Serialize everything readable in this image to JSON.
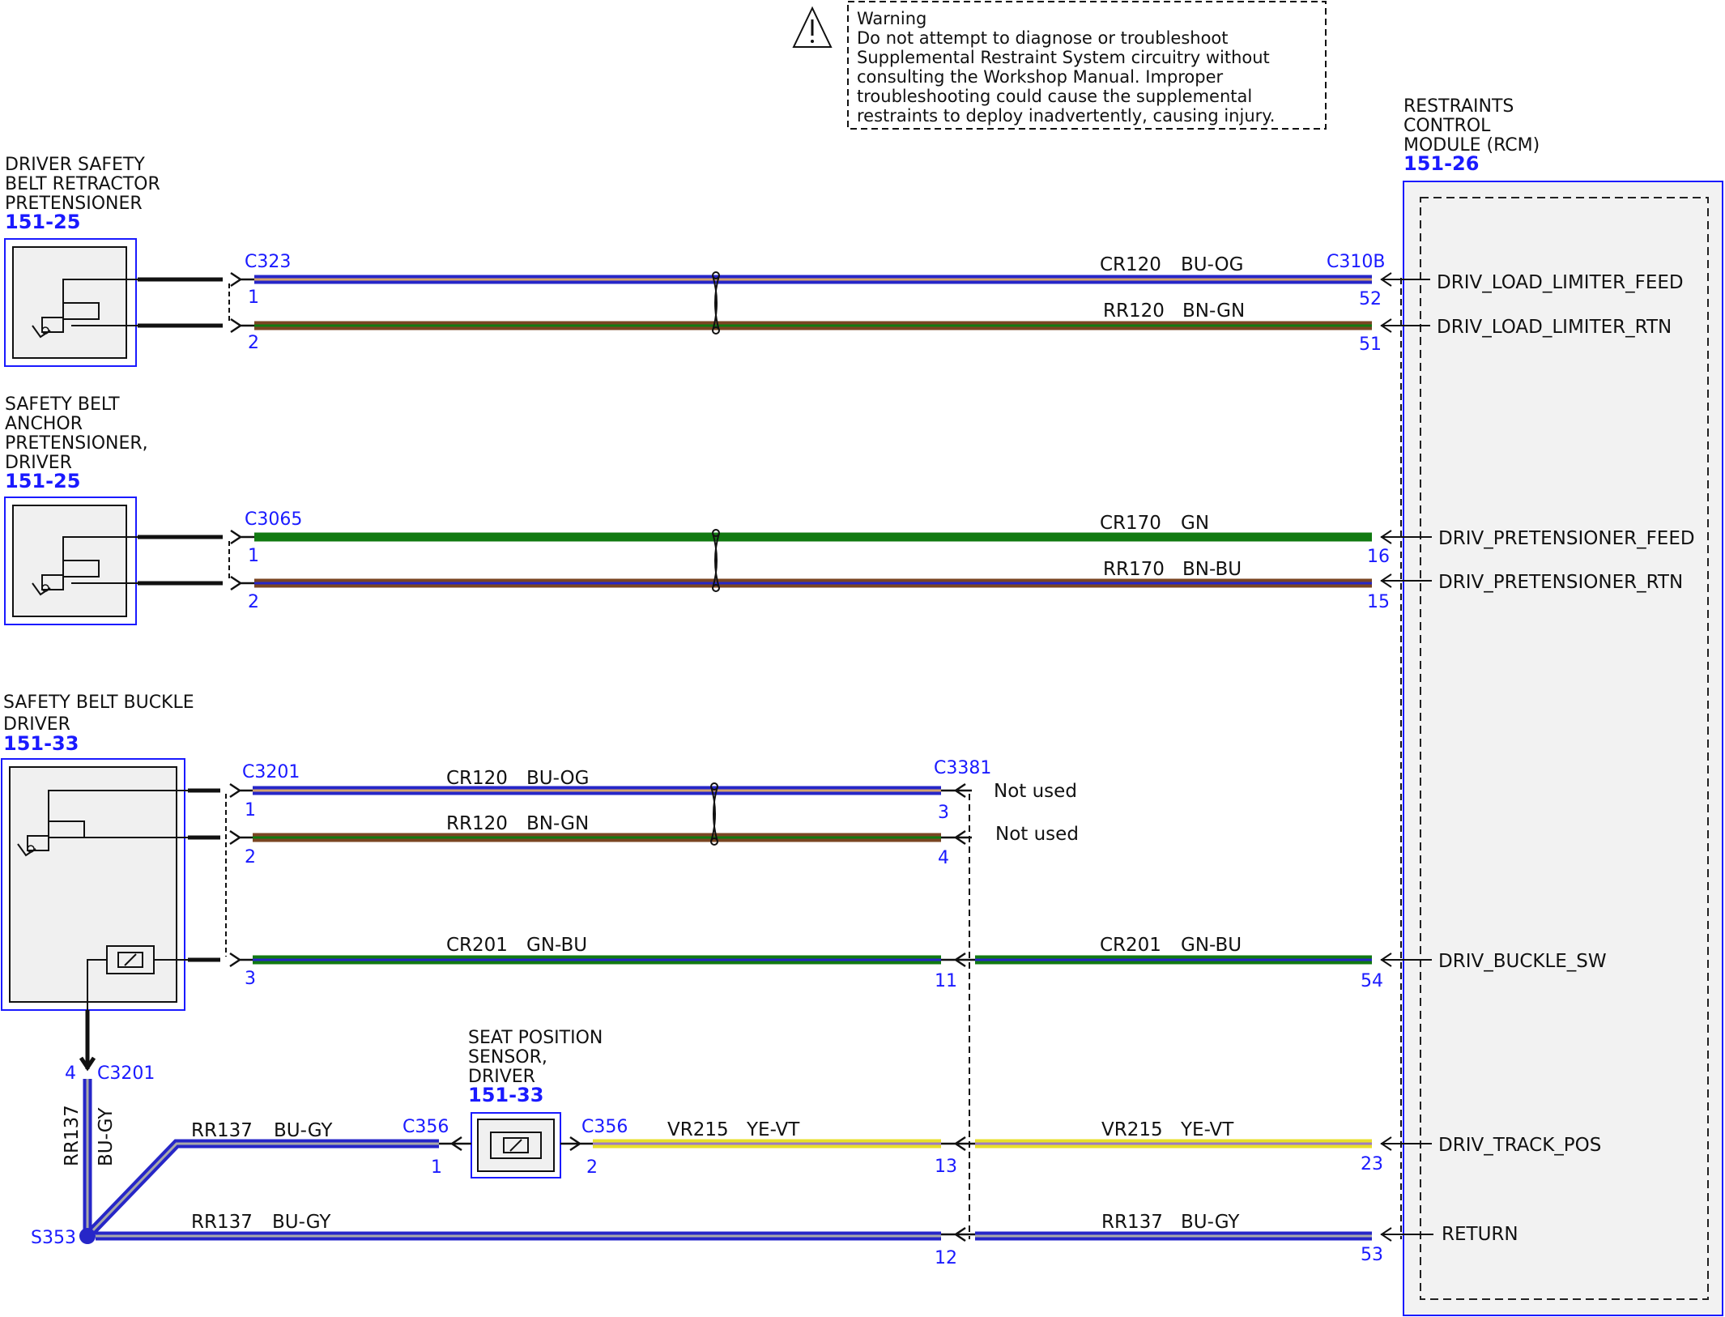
{
  "colors": {
    "BU": "#2626c8",
    "OG": "#d4a26e",
    "BN": "#7a4522",
    "GN": "#117a11",
    "GY": "#a9a9a9",
    "YE": "#e8df2a",
    "VT": "#9c7bc4",
    "component_border": "#1a1aff",
    "text_blue": "#1a1aff"
  },
  "warning": {
    "icon": "warning-triangle-icon",
    "lines": [
      "Warning",
      "Do not attempt to diagnose or troubleshoot",
      "Supplemental Restraint System circuitry without",
      "consulting the Workshop Manual. Improper",
      "troubleshooting could cause the supplemental",
      "restraints to deploy inadvertently, causing injury."
    ]
  },
  "rcm": {
    "name_lines": [
      "RESTRAINTS",
      "CONTROL",
      "MODULE (RCM)"
    ],
    "ref": "151-26",
    "connector": "C310B",
    "pins": [
      {
        "pin": "52",
        "signal": "DRIV_LOAD_LIMITER_FEED"
      },
      {
        "pin": "51",
        "signal": "DRIV_LOAD_LIMITER_RTN"
      },
      {
        "pin": "16",
        "signal": "DRIV_PRETENSIONER_FEED"
      },
      {
        "pin": "15",
        "signal": "DRIV_PRETENSIONER_RTN"
      },
      {
        "pin": "54",
        "signal": "DRIV_BUCKLE_SW"
      },
      {
        "pin": "23",
        "signal": "DRIV_TRACK_POS"
      },
      {
        "pin": "53",
        "signal": "RETURN"
      }
    ]
  },
  "components": {
    "retractor": {
      "name_lines": [
        "DRIVER SAFETY",
        "BELT RETRACTOR",
        "PRETENSIONER"
      ],
      "ref": "151-25",
      "connector": "C323",
      "pins": [
        "1",
        "2"
      ]
    },
    "anchor": {
      "name_lines": [
        "SAFETY BELT",
        "ANCHOR",
        "PRETENSIONER,",
        "DRIVER"
      ],
      "ref": "151-25",
      "connector": "C3065",
      "pins": [
        "1",
        "2"
      ]
    },
    "buckle": {
      "name_lines": [
        "SAFETY BELT BUCKLE",
        "DRIVER"
      ],
      "ref": "151-33",
      "connector": "C3201",
      "pins": [
        "1",
        "2",
        "3"
      ],
      "lower_pin": "4",
      "lower_connector": "C3201"
    },
    "seat_sensor": {
      "name_lines": [
        "SEAT POSITION",
        "SENSOR,",
        "DRIVER"
      ],
      "ref": "151-33",
      "connector_left": "C356",
      "connector_right": "C356",
      "pin_left": "1",
      "pin_right": "2"
    }
  },
  "inline_connector": {
    "name": "C3381",
    "pins": [
      "3",
      "4",
      "11",
      "13",
      "12"
    ],
    "not_used": [
      "Not used",
      "Not used"
    ]
  },
  "splice": {
    "name": "S353"
  },
  "wires": [
    {
      "circuit": "CR120",
      "color": "BU-OG"
    },
    {
      "circuit": "RR120",
      "color": "BN-GN"
    },
    {
      "circuit": "CR170",
      "color": "GN"
    },
    {
      "circuit": "RR170",
      "color": "BN-BU"
    },
    {
      "circuit": "CR120",
      "color": "BU-OG"
    },
    {
      "circuit": "RR120",
      "color": "BN-GN"
    },
    {
      "circuit": "CR201",
      "color": "GN-BU"
    },
    {
      "circuit": "CR201",
      "color": "GN-BU"
    },
    {
      "circuit": "VR215",
      "color": "YE-VT"
    },
    {
      "circuit": "VR215",
      "color": "YE-VT"
    },
    {
      "circuit": "RR137",
      "color": "BU-GY"
    },
    {
      "circuit": "RR137",
      "color": "BU-GY"
    },
    {
      "circuit": "RR137",
      "color": "BU-GY"
    },
    {
      "circuit": "RR137",
      "color": "BU-GY"
    }
  ]
}
